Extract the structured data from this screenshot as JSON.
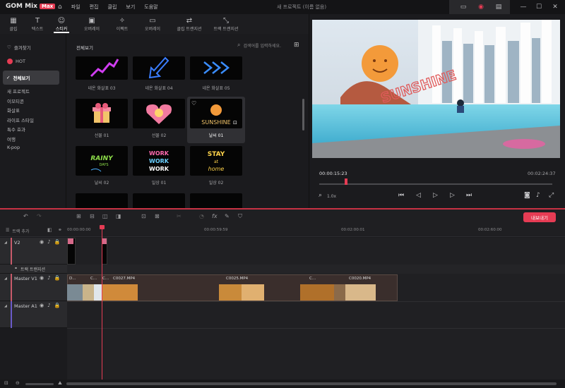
{
  "app": {
    "logo": "GOM Mix",
    "logo_badge": "Max",
    "project_title": "새 프로젝트 (이름 없음)"
  },
  "menu": [
    "파일",
    "편집",
    "클립",
    "보기",
    "도움말"
  ],
  "window": {
    "minimize": "—",
    "maximize": "☐",
    "close": "✕"
  },
  "tabs": [
    {
      "label": "클립",
      "icon": "▦"
    },
    {
      "label": "텍스트",
      "icon": "T"
    },
    {
      "label": "스티커",
      "icon": "☺"
    },
    {
      "label": "오버레이",
      "icon": "▣"
    },
    {
      "label": "이펙트",
      "icon": "✧"
    },
    {
      "label": "오버레이",
      "icon": "▭"
    },
    {
      "label": "클립 트랜지션",
      "icon": "⇄"
    },
    {
      "label": "트랙 트랜지션",
      "icon": "⤡"
    }
  ],
  "sidebar": {
    "favorites": "즐겨찾기",
    "hot": "HOT",
    "all": "전체보기",
    "categories": [
      "새 프로젝트",
      "이모티콘",
      "화살표",
      "라이프 스타일",
      "특수 효과",
      "여행",
      "K-pop"
    ]
  },
  "grid": {
    "heading": "전체보기",
    "search_placeholder": "검색어를 입력하세요.",
    "items": [
      "네온 화살표 03",
      "네온 화살표 04",
      "네온 화살표 05",
      "선물 01",
      "선물 02",
      "날씨 01",
      "날씨 02",
      "일상 01",
      "일상 02"
    ]
  },
  "preview": {
    "sticker_text": "SUNSHINE",
    "timecode": "00:00:15:23",
    "duration": "00:02:24:37",
    "zoom": "1.0x"
  },
  "timeline": {
    "export_label": "내보내기",
    "track_settings": "트랙 추가",
    "ruler": [
      "00:00:00:00",
      "00:00:59:59",
      "00:02:00:01",
      "00:02:60:00"
    ],
    "tracks": {
      "v2": "V2",
      "transition": "트랙 트랜지션",
      "v1": "Master V1",
      "a1": "Master A1"
    },
    "clips": [
      "D...",
      "C...",
      "C...",
      "C0027.MP4",
      "C0025.MP4",
      "C...",
      "C0020.MP4"
    ]
  },
  "colors": {
    "accent": "#e63c54",
    "panel": "#1b1b1e"
  }
}
